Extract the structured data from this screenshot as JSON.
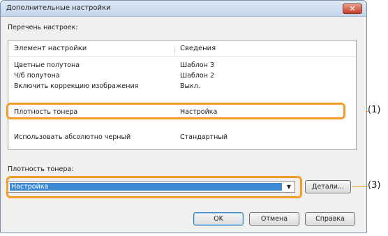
{
  "window": {
    "title": "Дополнительные настройки",
    "close_glyph": "✕"
  },
  "settings_list": {
    "label": "Перечень настроек:",
    "columns": [
      "Элемент настройки",
      "Сведения"
    ],
    "rows": [
      {
        "item": "Цветные полутона",
        "value": "Шаблон 3"
      },
      {
        "item": "Ч/б полутона",
        "value": "Шаблон 2"
      },
      {
        "item": "Включить коррекцию изображения",
        "value": "Выкл."
      },
      {
        "item": "Плотность тонера",
        "value": "Настройка"
      },
      {
        "item": "Использовать абсолютно черный",
        "value": "Стандартный"
      }
    ]
  },
  "toner_density": {
    "label": "Плотность тонера:",
    "selected": "Настройка",
    "details_button": "Детали..."
  },
  "buttons": {
    "ok": "OK",
    "cancel": "Отмена",
    "help": "Справка"
  },
  "callouts": {
    "list_marker": "(1)",
    "combo_marker": "(3)"
  },
  "colors": {
    "accent_outline": "#f39c27",
    "selection": "#3c8ad6"
  }
}
